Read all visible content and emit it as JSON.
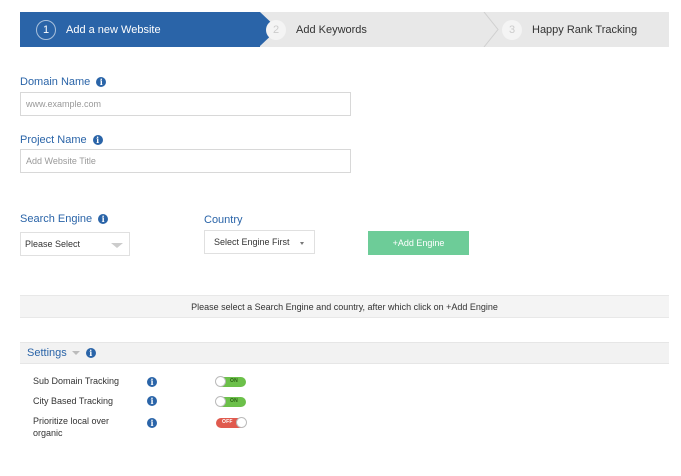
{
  "stepper": {
    "steps": [
      {
        "number": "1",
        "label": "Add a new Website"
      },
      {
        "number": "2",
        "label": "Add Keywords"
      },
      {
        "number": "3",
        "label": "Happy Rank Tracking"
      }
    ]
  },
  "domain": {
    "label": "Domain Name",
    "placeholder": "www.example.com",
    "value": ""
  },
  "project": {
    "label": "Project Name",
    "placeholder": "Add Website Title",
    "value": ""
  },
  "search_engine": {
    "label": "Search Engine",
    "selected": "Please Select"
  },
  "country": {
    "label": "Country",
    "selected": "Select Engine First"
  },
  "add_engine_label": "+Add Engine",
  "notice": "Please select a Search Engine and country, after which click on +Add Engine",
  "settings": {
    "title": "Settings",
    "items": [
      {
        "label": "Sub Domain Tracking",
        "state": "ON"
      },
      {
        "label": "City Based Tracking",
        "state": "ON"
      },
      {
        "label": "Prioritize local over organic",
        "state": "OFF"
      }
    ]
  },
  "colors": {
    "primary": "#2a64a8",
    "button_green": "#6dcc98",
    "toggle_on": "#6cc04a",
    "toggle_off": "#e05a4e"
  },
  "icons": {
    "info": "info-icon",
    "dropdown": "chevron-down-icon"
  }
}
